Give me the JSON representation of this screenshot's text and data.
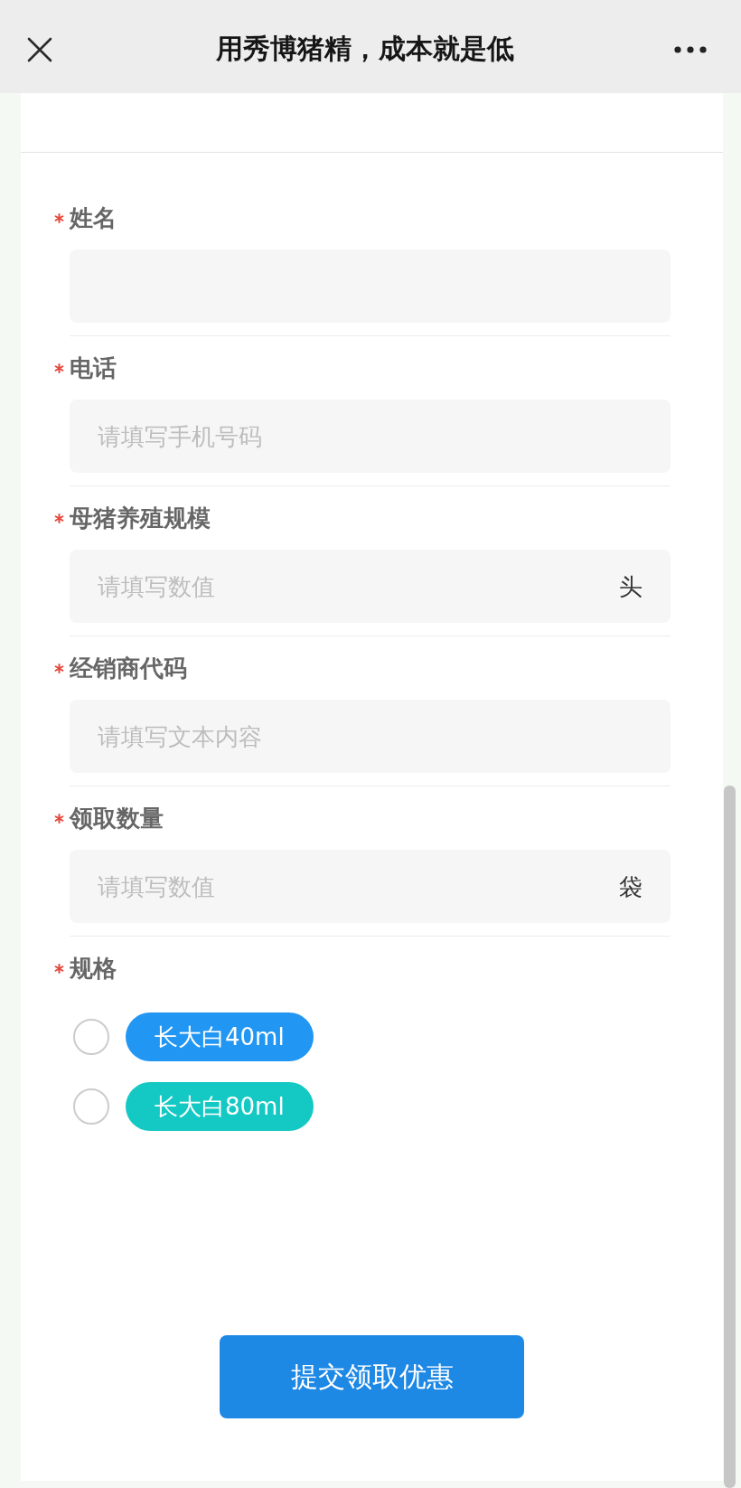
{
  "nav_bar": {
    "title": "用秀博猪精，成本就是低"
  },
  "form": {
    "fields": [
      {
        "kind": "input",
        "label": "姓名",
        "required": true
      },
      {
        "kind": "input",
        "label": "电话",
        "required": true,
        "placeholder": "请填写手机号码"
      },
      {
        "kind": "input",
        "label": "母猪养殖规模",
        "required": true,
        "placeholder": "请填写数值",
        "unit": "头"
      },
      {
        "kind": "input",
        "label": "经销商代码",
        "required": true,
        "placeholder": "请填写文本内容"
      },
      {
        "kind": "input",
        "label": "领取数量",
        "required": true,
        "placeholder": "请填写数值",
        "unit": "袋"
      },
      {
        "kind": "radio",
        "label": "规格",
        "required": true,
        "options": [
          {
            "label": "长大白40ml",
            "selected": false,
            "color": "#2196f3"
          },
          {
            "label": "长大白80ml",
            "selected": false,
            "color": "#14c8c4"
          }
        ]
      }
    ]
  },
  "submit_button": {
    "label": "提交领取优惠"
  }
}
